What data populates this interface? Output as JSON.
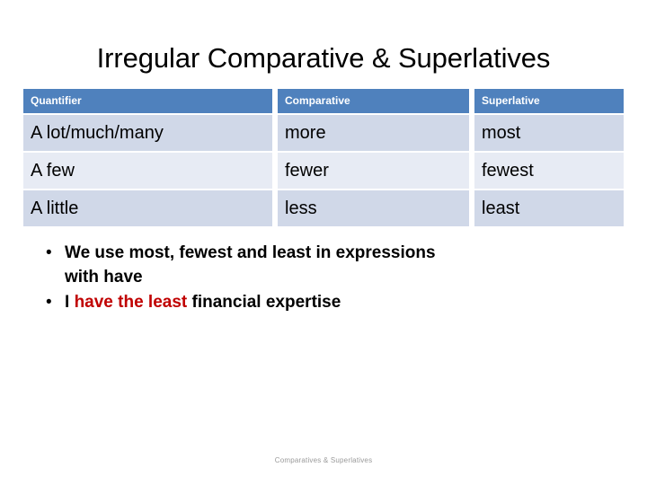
{
  "slide": {
    "title": "Irregular Comparative & Superlatives",
    "footer": "Comparatives & Superlatives"
  },
  "colors": {
    "header_blue": "#4F81BD",
    "row_shade_dark": "#D0D8E8",
    "row_shade_light": "#E7EBF4",
    "accent_red": "#C00000",
    "body_text": "#000000",
    "footer_text": "#9a9a9a",
    "background": "#ffffff"
  },
  "table": {
    "headers": [
      "Quantifier",
      "Comparative",
      "Superlative"
    ],
    "rows": [
      {
        "quantifier": "A lot/much/many",
        "comparative": "more",
        "superlative": "most"
      },
      {
        "quantifier": "A few",
        "comparative": "fewer",
        "superlative": "fewest"
      },
      {
        "quantifier": "A little",
        "comparative": "less",
        "superlative": "least"
      }
    ]
  },
  "bullets": {
    "marker": "•",
    "items": [
      {
        "line1_pre": "We use most, fewest and least in expressions",
        "line2": "with have"
      },
      {
        "pre": "I ",
        "highlight": "have the least",
        "post": " financial expertise"
      }
    ]
  }
}
